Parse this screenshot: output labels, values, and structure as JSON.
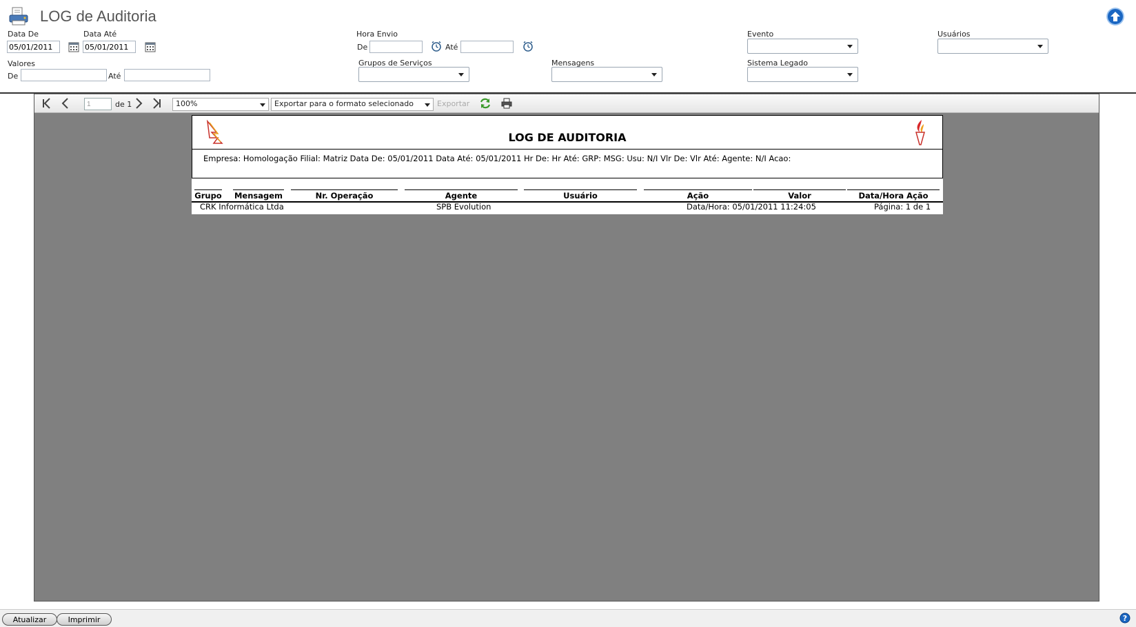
{
  "header": {
    "title": "LOG de Auditoria"
  },
  "filters": {
    "data_de_label": "Data De",
    "data_de_value": "05/01/2011",
    "data_ate_label": "Data Até",
    "data_ate_value": "05/01/2011",
    "hora_envio_label": "Hora Envio",
    "hora_de_label": "De",
    "hora_de_value": "",
    "hora_ate_label": "Até",
    "hora_ate_value": "",
    "evento_label": "Evento",
    "usuarios_label": "Usuários",
    "valores_label": "Valores",
    "valores_de_label": "De",
    "valores_de_value": "",
    "valores_ate_label": "Até",
    "valores_ate_value": "",
    "grupos_label": "Grupos de Serviços",
    "mensagens_label": "Mensagens",
    "sistema_label": "Sistema Legado"
  },
  "toolbar": {
    "page_value": "1",
    "page_of": "de 1",
    "zoom": "100%",
    "export_format": "Exportar para o formato selecionado",
    "export_label": "Exportar"
  },
  "report": {
    "title": "LOG DE AUDITORIA",
    "filter_line": "Empresa: Homologação Filial: Matriz Data De: 05/01/2011 Data Até: 05/01/2011 Hr De: Hr Até: GRP: MSG: Usu: N/I Vlr De: Vlr Até: Agente: N/I Acao:",
    "columns": [
      "Grupo",
      "Mensagem",
      "Nr. Operação",
      "Agente",
      "Usuário",
      "Ação",
      "Valor",
      "Data/Hora Ação"
    ],
    "footer": {
      "company": "CRK Informática Ltda",
      "product": "SPB Evolution",
      "datetime": "Data/Hora: 05/01/2011 11:24:05",
      "page": "Página: 1 de 1"
    }
  },
  "bottom": {
    "atualizar": "Atualizar",
    "imprimir": "Imprimir"
  },
  "colors": {
    "viewer_bg": "#808080",
    "accent_blue": "#1a66c2"
  }
}
